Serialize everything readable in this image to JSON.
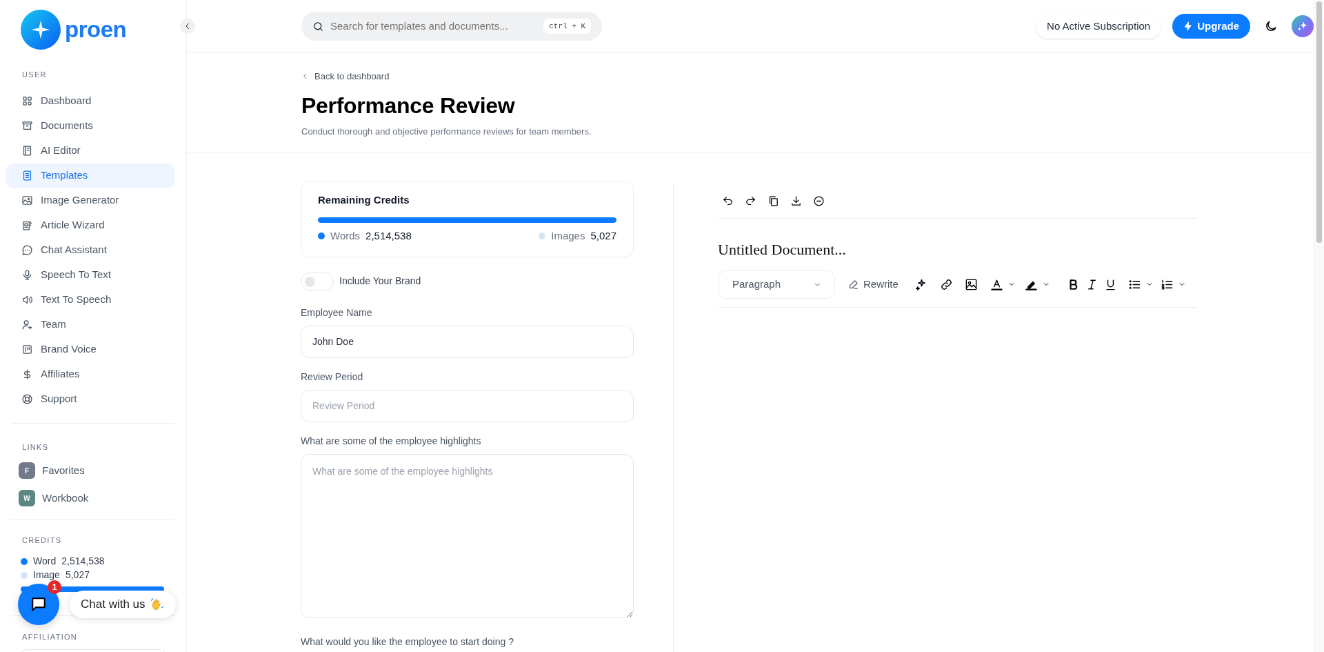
{
  "brand": {
    "name": "proen"
  },
  "sidebar": {
    "user_title": "USER",
    "items": [
      {
        "label": "Dashboard",
        "selected": false
      },
      {
        "label": "Documents",
        "selected": false
      },
      {
        "label": "AI Editor",
        "selected": false
      },
      {
        "label": "Templates",
        "selected": true
      },
      {
        "label": "Image Generator",
        "selected": false
      },
      {
        "label": "Article Wizard",
        "selected": false
      },
      {
        "label": "Chat Assistant",
        "selected": false
      },
      {
        "label": "Speech To Text",
        "selected": false
      },
      {
        "label": "Text To Speech",
        "selected": false
      },
      {
        "label": "Team",
        "selected": false
      },
      {
        "label": "Brand Voice",
        "selected": false
      },
      {
        "label": "Affiliates",
        "selected": false
      },
      {
        "label": "Support",
        "selected": false
      }
    ],
    "links_title": "LINKS",
    "links": [
      {
        "initial": "F",
        "label": "Favorites",
        "color": "#737a8c"
      },
      {
        "initial": "W",
        "label": "Workbook",
        "color": "#5d8783"
      }
    ],
    "credits_title": "CREDITS",
    "credits": [
      {
        "label": "Word",
        "value": "2,514,538",
        "color": "#0b7bff"
      },
      {
        "label": "Image",
        "value": "5,027",
        "color": "#d6e4f5"
      }
    ],
    "credits_bar": {
      "level": 1
    },
    "affiliation_title": "AFFILIATION"
  },
  "topbar": {
    "search": {
      "placeholder": "Search for templates and documents...",
      "shortcut": "ctrl + K"
    },
    "subscription": "No Active Subscription",
    "upgrade": "Upgrade"
  },
  "header": {
    "back": "Back to dashboard",
    "title": "Performance Review",
    "subtitle": "Conduct thorough and objective performance reviews for team members."
  },
  "credits_card": {
    "title": "Remaining Credits",
    "level": 1,
    "items": [
      {
        "label": "Words",
        "value": "2,514,538",
        "color": "#0b7bff"
      },
      {
        "label": "Images",
        "value": "5,027",
        "color": "#d6e4f5"
      }
    ]
  },
  "brand_toggle": {
    "label": "Include Your Brand",
    "on": false
  },
  "fields": [
    {
      "kind": "input",
      "label": "Employee Name",
      "value": "John Doe"
    },
    {
      "kind": "input",
      "label": "Review Period",
      "placeholder": "Review Period"
    },
    {
      "kind": "textarea",
      "label": "What are some of the employee highlights",
      "placeholder": "What are some of the employee highlights"
    },
    {
      "kind": "label",
      "label": "What would you like the employee to start doing ?"
    }
  ],
  "editor": {
    "title": "Untitled Document...",
    "block_style": "Paragraph",
    "rewrite": "Rewrite"
  },
  "chat_widget": {
    "badge": "1",
    "label": "Chat with us"
  }
}
